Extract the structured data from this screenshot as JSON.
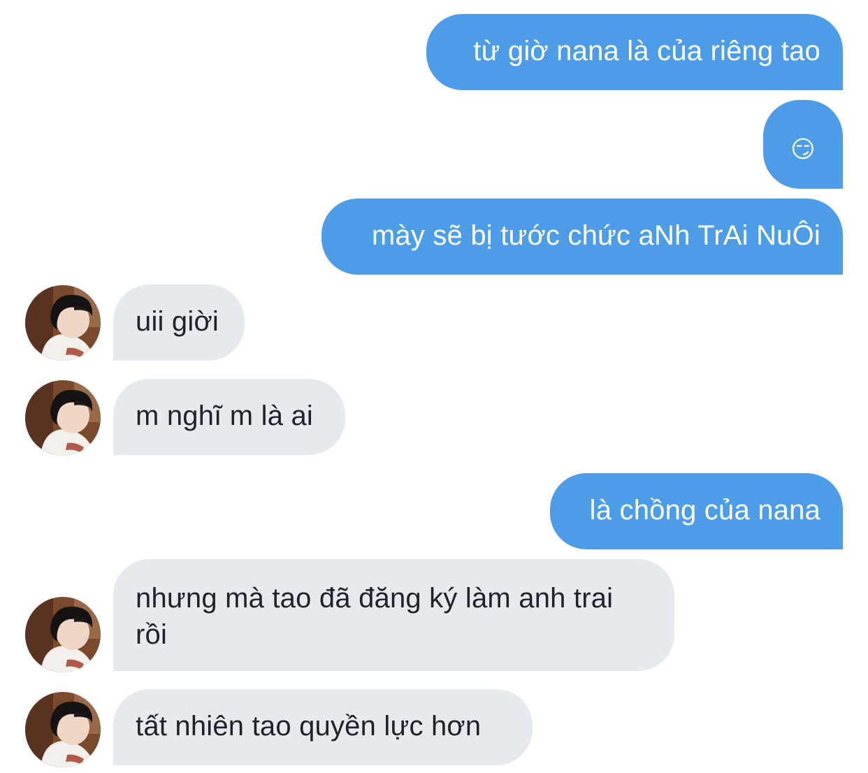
{
  "conversation": {
    "messages": [
      {
        "sender": "me",
        "text": "từ giờ nana là của riêng tao"
      },
      {
        "sender": "me",
        "text": "😏",
        "icon": "smirking-face-icon"
      },
      {
        "sender": "me",
        "text": "mày sẽ bị tước chức aNh TrAi NuÔi"
      },
      {
        "sender": "them",
        "text": "uii giời"
      },
      {
        "sender": "them",
        "text": "m nghĩ m là ai"
      },
      {
        "sender": "me",
        "text": "là chồng của nana"
      },
      {
        "sender": "them",
        "text": "nhưng mà tao đã đăng ký làm anh trai rồi"
      },
      {
        "sender": "them",
        "text": "tất nhiên tao quyền lực hơn"
      }
    ]
  },
  "colors": {
    "outgoing_bubble": "#4c9ce8",
    "incoming_bubble": "#e6e9ee",
    "incoming_text": "#1f2329",
    "background": "#ffffff"
  }
}
